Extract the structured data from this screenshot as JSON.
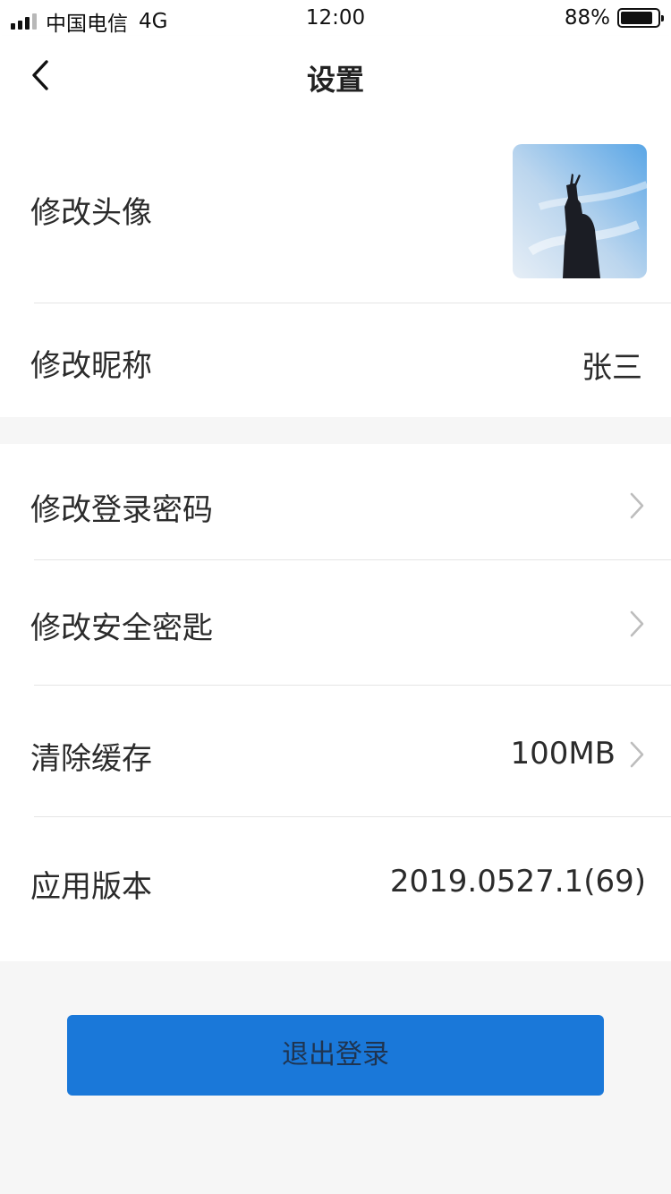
{
  "status_bar": {
    "carrier": "中国电信",
    "network": "4G",
    "time": "12:00",
    "battery_percent_text": "88%",
    "battery_level": 0.88,
    "signal_bars_active": 3,
    "signal_bars_total": 4
  },
  "nav": {
    "title": "设置",
    "back_icon": "chevron-left-icon"
  },
  "profile": {
    "avatar_label": "修改头像",
    "nickname_label": "修改昵称",
    "nickname_value": "张三"
  },
  "settings": {
    "login_password_label": "修改登录密码",
    "security_key_label": "修改安全密匙",
    "clear_cache_label": "清除缓存",
    "cache_size": "100MB",
    "app_version_label": "应用版本",
    "app_version_value": "2019.0527.1(69)"
  },
  "actions": {
    "logout_label": "退出登录"
  },
  "colors": {
    "accent": "#1a78d9",
    "background": "#f6f6f6",
    "divider": "#e5e5e5"
  }
}
